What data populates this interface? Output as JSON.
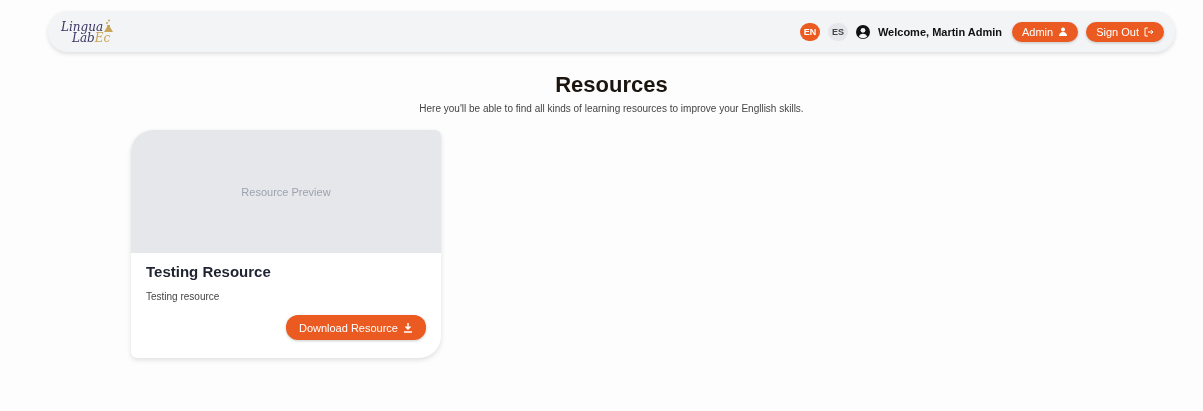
{
  "header": {
    "logo": {
      "line_1": "Lingua",
      "line_2": "Lab",
      "line_2_accent": "Ec"
    },
    "languages": [
      {
        "label": "EN",
        "selected": true
      },
      {
        "label": "ES",
        "selected": false
      }
    ],
    "welcome": "Welcome, Martin Admin",
    "buttons": [
      {
        "label": "Admin",
        "kind": "admin"
      },
      {
        "label": "Sign Out",
        "kind": "signout"
      }
    ]
  },
  "page": {
    "title": "Resources",
    "subtitle": "Here you'll be able to find all kinds of learning resources to improve your Engllish skills."
  },
  "resources": [
    {
      "preview": "Resource Preview",
      "title": "Testing Resource",
      "description": "Testing resource",
      "button": "Download Resource"
    }
  ]
}
